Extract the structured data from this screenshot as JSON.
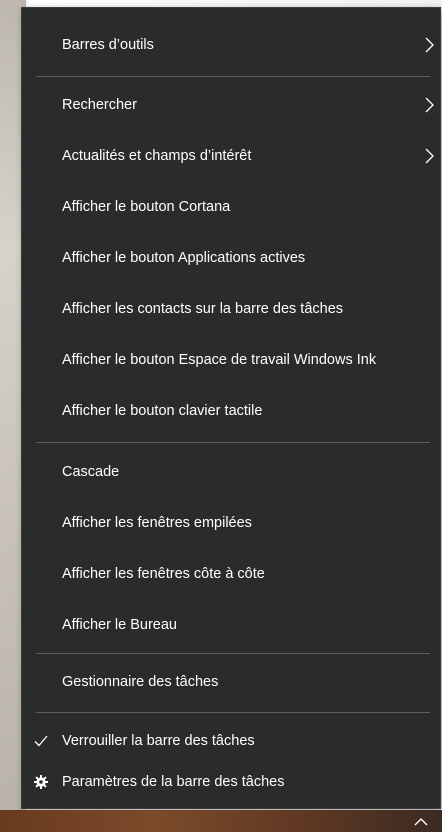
{
  "menu": {
    "items": [
      {
        "label": "Barres d’outils",
        "submenu": true
      },
      {
        "label": "Rechercher",
        "submenu": true
      },
      {
        "label": "Actualités et champs d’intérêt",
        "submenu": true
      },
      {
        "label": "Afficher le bouton Cortana",
        "submenu": false
      },
      {
        "label": "Afficher le bouton Applications actives",
        "submenu": false
      },
      {
        "label": "Afficher les contacts sur la barre des tâches",
        "submenu": false
      },
      {
        "label": "Afficher le bouton Espace de travail Windows Ink",
        "submenu": false
      },
      {
        "label": "Afficher le bouton clavier tactile",
        "submenu": false
      },
      {
        "label": "Cascade",
        "submenu": false
      },
      {
        "label": "Afficher les fenêtres empilées",
        "submenu": false
      },
      {
        "label": "Afficher les fenêtres côte à côte",
        "submenu": false
      },
      {
        "label": "Afficher le Bureau",
        "submenu": false
      },
      {
        "label": "Gestionnaire des tâches",
        "submenu": false
      },
      {
        "label": "Verrouiller la barre des tâches",
        "checked": true,
        "icon": "check-icon"
      },
      {
        "label": "Paramètres de la barre des tâches",
        "icon": "gear-icon"
      }
    ]
  },
  "colors": {
    "menu_background": "#2b2b2b",
    "menu_text": "#ffffff",
    "separator": "#5e5e5e"
  },
  "taskbar": {
    "tray_icon": "chevron-up-icon"
  }
}
